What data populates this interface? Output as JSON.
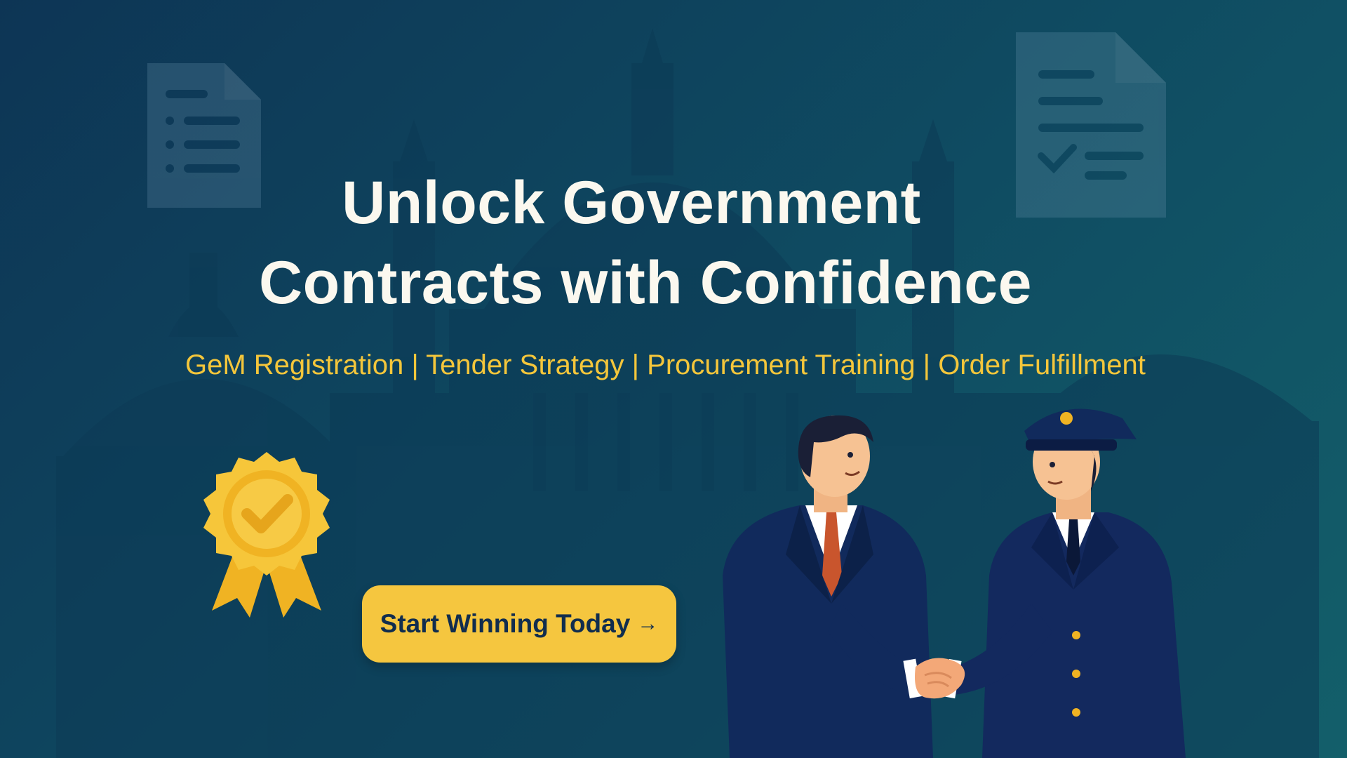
{
  "headline": {
    "line1": "Unlock Government",
    "line2": "Contracts with Confidence"
  },
  "services": [
    "GeM Registration",
    "Tender Strategy",
    "Procurement Training",
    "Order Fulfillment"
  ],
  "services_separator": " | ",
  "cta": {
    "label": "Start Winning Today",
    "arrow": "→"
  },
  "icons": [
    "document-list-icon",
    "document-check-icon",
    "award-badge-icon",
    "handshake-illustration",
    "government-building-silhouette"
  ],
  "colors": {
    "background_start": "#0d3555",
    "background_end": "#135f6a",
    "headline": "#fbf8ef",
    "accent": "#f4c63b",
    "cta_text": "#112d4e",
    "suit": "#0f2551"
  }
}
